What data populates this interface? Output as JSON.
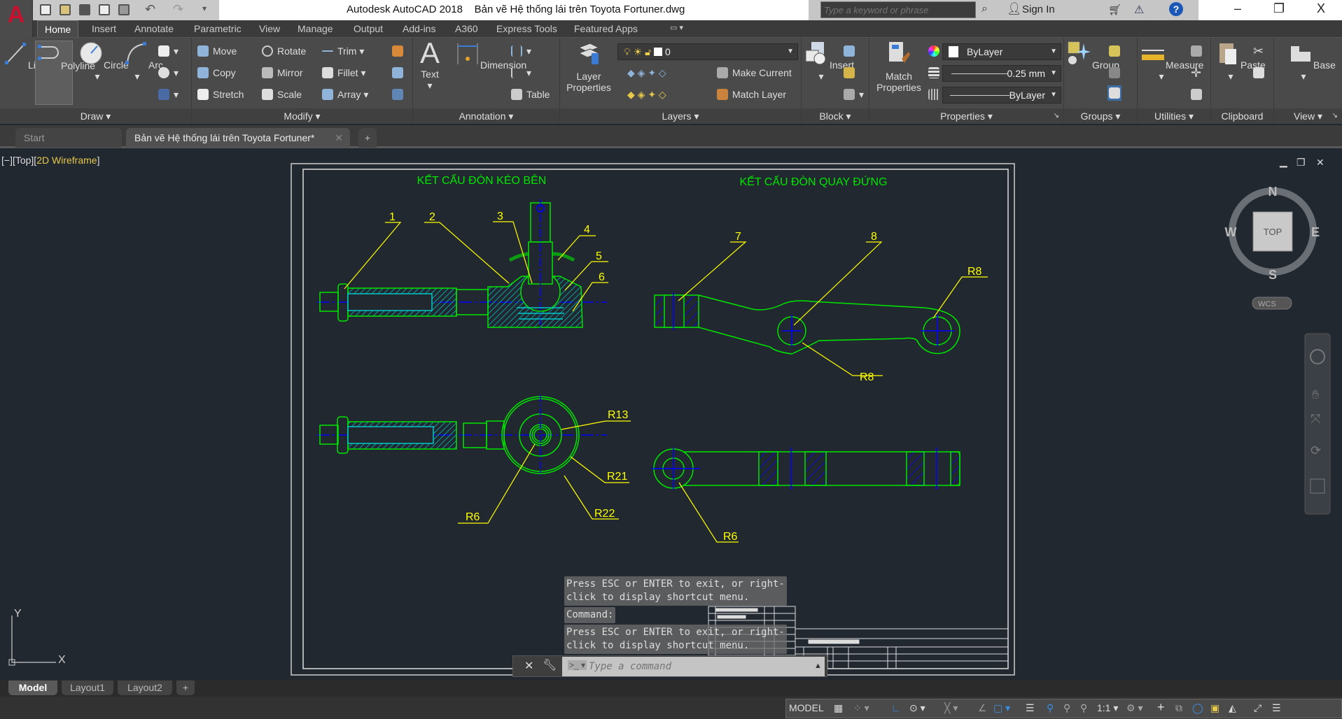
{
  "app": {
    "title": "Autodesk AutoCAD 2018    Bản vẽ Hệ thống lái trên Toyota Fortuner.dwg",
    "logo": "A",
    "search_placeholder": "Type a keyword or phrase",
    "sign_in": "Sign In"
  },
  "window_controls": {
    "minimize": "–",
    "restore": "❐",
    "close": "X"
  },
  "menu_tabs": [
    "Home",
    "Insert",
    "Annotate",
    "Parametric",
    "View",
    "Manage",
    "Output",
    "Add-ins",
    "A360",
    "Express Tools",
    "Featured Apps"
  ],
  "ribbon": {
    "draw": {
      "title": "Draw ▾",
      "line": "Line",
      "polyline": "Polyline",
      "circle": "Circle",
      "arc": "Arc"
    },
    "modify": {
      "title": "Modify ▾",
      "move": "Move",
      "rotate": "Rotate",
      "trim": "Trim",
      "copy": "Copy",
      "mirror": "Mirror",
      "fillet": "Fillet",
      "stretch": "Stretch",
      "scale": "Scale",
      "array": "Array"
    },
    "annotation": {
      "title": "Annotation ▾",
      "text": "Text",
      "dimension": "Dimension",
      "table": "Table"
    },
    "layers": {
      "title": "Layers ▾",
      "layer_properties": "Layer Properties",
      "current_layer": "0",
      "make_current": "Make Current",
      "match_layer": "Match Layer"
    },
    "block": {
      "title": "Block ▾",
      "insert": "Insert"
    },
    "properties": {
      "title": "Properties ▾",
      "match_properties": "Match Properties",
      "color": "ByLayer",
      "lineweight": "0.25 mm",
      "linetype": "ByLayer"
    },
    "groups": {
      "title": "Groups ▾",
      "group": "Group"
    },
    "utilities": {
      "title": "Utilities ▾",
      "measure": "Measure"
    },
    "clipboard": {
      "title": "Clipboard",
      "paste": "Paste"
    },
    "view": {
      "title": "View ▾",
      "base": "Base"
    }
  },
  "doc_tabs": {
    "start": "Start",
    "file": "Bản vẽ Hệ thống lái trên Toyota Fortuner*",
    "add": "+"
  },
  "viewport": {
    "controls": "[−][Top][",
    "visual_style": "2D Wireframe",
    "close_bracket": "]"
  },
  "drawing": {
    "title_left": "KẾT CẤU ĐÒN KÉO BÊN",
    "title_right": "KẾT CẤU ĐÒN QUAY ĐỨNG",
    "labels": [
      "1",
      "2",
      "3",
      "4",
      "5",
      "6",
      "7",
      "8"
    ],
    "dims": {
      "r13": "R13",
      "r21": "R21",
      "r22": "R22",
      "r6_left": "R6",
      "r8_top": "R8",
      "r8_bottom": "R8",
      "r6_right": "R6"
    },
    "colors": {
      "outline": "#00e600",
      "leader": "#ffff00",
      "center": "#0000ff",
      "hatch": "#00c8c8"
    }
  },
  "viewcube": {
    "n": "N",
    "s": "S",
    "e": "E",
    "w": "W",
    "face": "TOP",
    "wcs": "WCS"
  },
  "ucs": {
    "x": "X",
    "y": "Y"
  },
  "command": {
    "msg1": "Press ESC or ENTER to exit, or right-\nclick to display shortcut menu.",
    "prompt": "Command:",
    "msg2": "Press ESC or ENTER to exit, or right-\nclick to display shortcut menu.",
    "placeholder": "Type a command"
  },
  "layout_tabs": [
    "Model",
    "Layout1",
    "Layout2",
    "+"
  ],
  "status": {
    "model": "MODEL",
    "scale": "1:1"
  }
}
